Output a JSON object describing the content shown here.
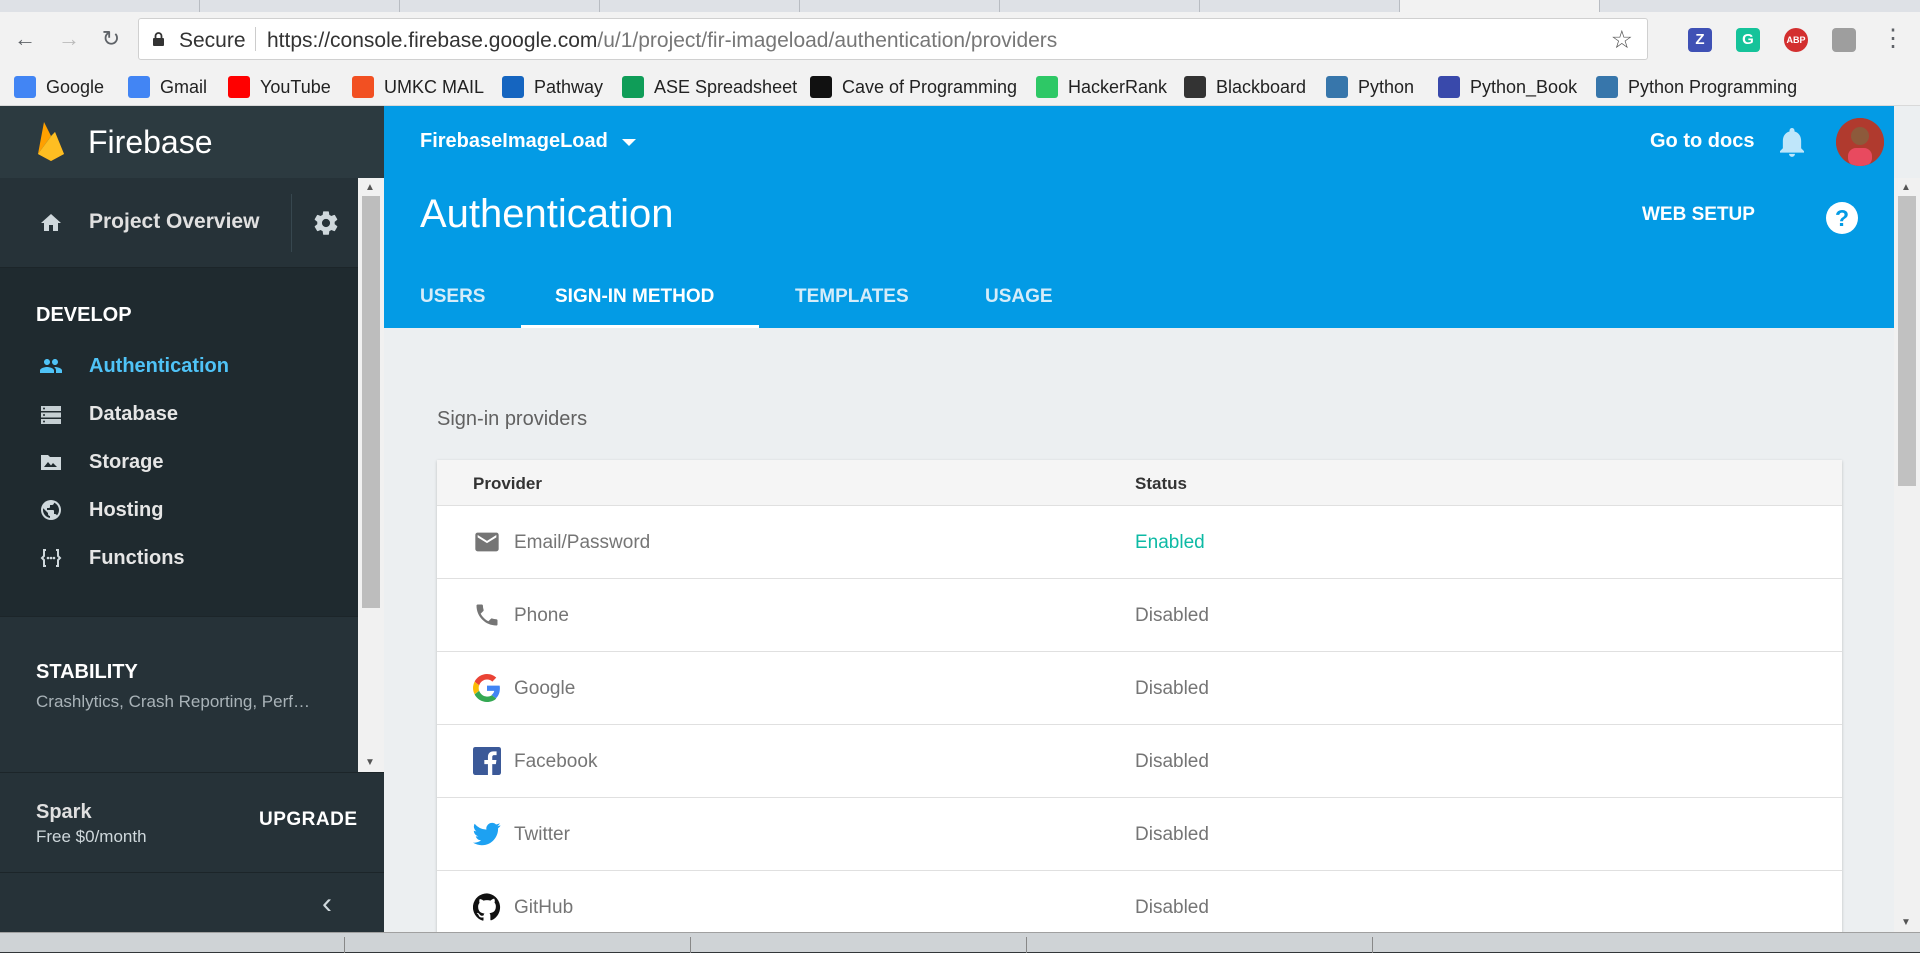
{
  "browser": {
    "secure_label": "Secure",
    "url_host": "https://console.firebase.google.com",
    "url_path": "/u/1/project/fir-imageload/authentication/providers",
    "extensions": [
      {
        "name": "z-extension-icon",
        "text": "Z",
        "color": "#3f51b5"
      },
      {
        "name": "grammarly-icon",
        "text": "G",
        "color": "#15c39a"
      },
      {
        "name": "adblock-plus-icon",
        "text": "ABP",
        "color": "#d32f2f"
      },
      {
        "name": "extension-icon",
        "text": "",
        "color": "#9e9e9e"
      }
    ],
    "bookmarks": [
      {
        "label": "Google",
        "color": "#4285f4"
      },
      {
        "label": "Gmail",
        "color": "#4285f4"
      },
      {
        "label": "YouTube",
        "color": "#ff0000"
      },
      {
        "label": "UMKC MAIL",
        "color": "#f25022"
      },
      {
        "label": "Pathway",
        "color": "#1565c0"
      },
      {
        "label": "ASE Spreadsheet",
        "color": "#0f9d58"
      },
      {
        "label": "Cave of Programming",
        "color": "#111111"
      },
      {
        "label": "HackerRank",
        "color": "#2ec866"
      },
      {
        "label": "Blackboard",
        "color": "#333333"
      },
      {
        "label": "Python",
        "color": "#3776ab"
      },
      {
        "label": "Python_Book",
        "color": "#3949ab"
      },
      {
        "label": "Python Programming",
        "color": "#3776ab"
      }
    ]
  },
  "sidebar": {
    "brand": "Firebase",
    "overview": "Project Overview",
    "develop_heading": "DEVELOP",
    "items": [
      {
        "label": "Authentication",
        "icon": "people-icon",
        "active": true
      },
      {
        "label": "Database",
        "icon": "database-icon",
        "active": false
      },
      {
        "label": "Storage",
        "icon": "storage-icon",
        "active": false
      },
      {
        "label": "Hosting",
        "icon": "globe-icon",
        "active": false
      },
      {
        "label": "Functions",
        "icon": "functions-icon",
        "active": false
      }
    ],
    "stability_heading": "STABILITY",
    "stability_sub": "Crashlytics, Crash Reporting, Perf…",
    "plan_name": "Spark",
    "plan_price": "Free $0/month",
    "upgrade": "UPGRADE"
  },
  "header": {
    "project": "FirebaseImageLoad",
    "docs": "Go to docs",
    "title": "Authentication",
    "web_setup": "WEB SETUP",
    "help": "?",
    "tabs": [
      "USERS",
      "SIGN-IN METHOD",
      "TEMPLATES",
      "USAGE"
    ],
    "active_tab": "SIGN-IN METHOD"
  },
  "main": {
    "section_title": "Sign-in providers",
    "col_provider": "Provider",
    "col_status": "Status",
    "providers": [
      {
        "name": "Email/Password",
        "status": "Enabled",
        "icon": "email-icon"
      },
      {
        "name": "Phone",
        "status": "Disabled",
        "icon": "phone-icon"
      },
      {
        "name": "Google",
        "status": "Disabled",
        "icon": "google-icon"
      },
      {
        "name": "Facebook",
        "status": "Disabled",
        "icon": "facebook-icon"
      },
      {
        "name": "Twitter",
        "status": "Disabled",
        "icon": "twitter-icon"
      },
      {
        "name": "GitHub",
        "status": "Disabled",
        "icon": "github-icon"
      }
    ]
  },
  "colors": {
    "header_blue": "#039be5",
    "sidebar_dark": "#263238",
    "active_link": "#4fc3f7",
    "enabled_green": "#0dbaa5"
  }
}
